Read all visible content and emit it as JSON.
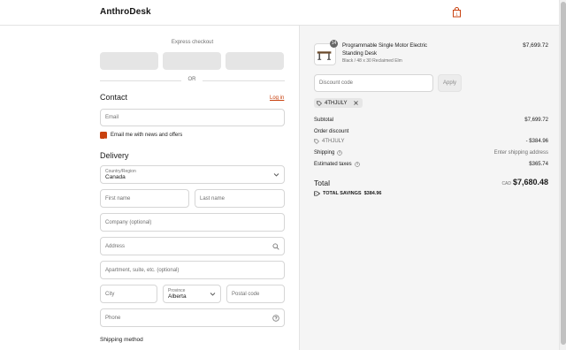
{
  "header": {
    "brand": "AnthroDesk",
    "cart_icon": "shopping-bag-icon",
    "accent_color": "#c8410f"
  },
  "express": {
    "label": "Express checkout",
    "or_label": "OR"
  },
  "contact": {
    "title": "Contact",
    "login_label": "Log in",
    "email_placeholder": "Email",
    "newsletter_label": "Email me with news and offers",
    "newsletter_checked": true
  },
  "delivery": {
    "title": "Delivery",
    "country_label": "Country/Region",
    "country_value": "Canada",
    "first_name_placeholder": "First name",
    "last_name_placeholder": "Last name",
    "company_placeholder": "Company (optional)",
    "address_placeholder": "Address",
    "apartment_placeholder": "Apartment, suite, etc. (optional)",
    "city_placeholder": "City",
    "province_label": "Province",
    "province_value": "Alberta",
    "postal_placeholder": "Postal code",
    "phone_placeholder": "Phone"
  },
  "shipping_method": {
    "title": "Shipping method"
  },
  "order": {
    "item": {
      "name": "Programmable Single Motor Electric Standing Desk",
      "variant": "Black / 48 x 30 Reclaimed Elm",
      "quantity": "14",
      "price": "$7,699.72"
    },
    "discount_placeholder": "Discount code",
    "apply_label": "Apply",
    "applied_code": "4THJULY",
    "subtotal_label": "Subtotal",
    "subtotal_value": "$7,699.72",
    "order_discount_label": "Order discount",
    "discount_code": "4THJULY",
    "discount_value": "- $384.96",
    "shipping_label": "Shipping",
    "shipping_value": "Enter shipping address",
    "taxes_label": "Estimated taxes",
    "taxes_value": "$365.74",
    "total_label": "Total",
    "total_currency": "CAD",
    "total_value": "$7,680.48",
    "savings_label": "TOTAL SAVINGS",
    "savings_value": "$384.96"
  }
}
